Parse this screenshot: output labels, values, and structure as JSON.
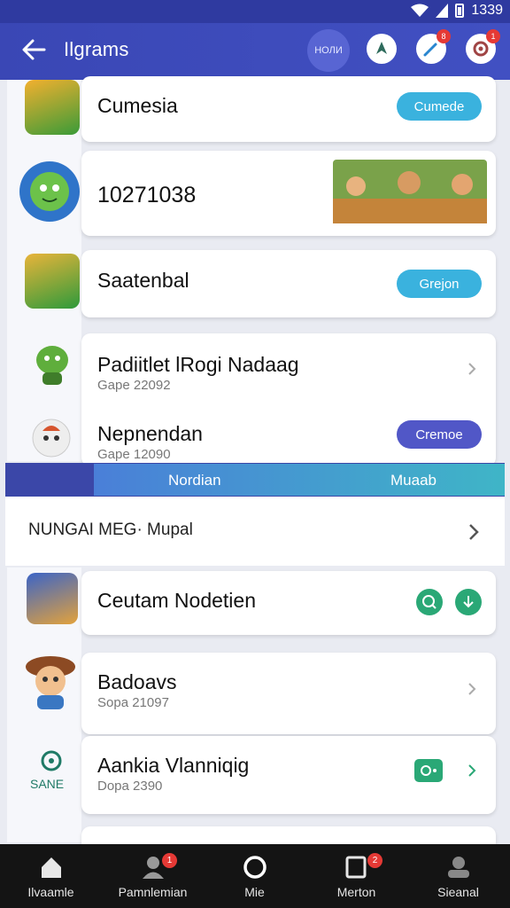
{
  "status_bar": {
    "time": "1339"
  },
  "app_bar": {
    "title": "Ilgrams",
    "pill_label": "НОЛИ",
    "badge_1": "8",
    "badge_2": "1"
  },
  "rows": [
    {
      "name": "Cumesia",
      "button": "Cumede",
      "button_color": "#3ab2de"
    },
    {
      "name": "10271038"
    },
    {
      "name": "Saatenbal",
      "button": "Grejon",
      "button_color": "#3ab2de"
    },
    {
      "name": "Padiitlet lRogi Nadaag",
      "sub": "Gape 22092"
    },
    {
      "name": "Nepnendan",
      "sub": "Gape 12090",
      "button": "Cremoe",
      "button_color": "#5157c7"
    }
  ],
  "gradient_bar": {
    "left": "Nordian",
    "right": "Muaab"
  },
  "section": {
    "title": "NUNGAI MEG· Mupal"
  },
  "rows2": [
    {
      "name": "Ceutam Nodetien"
    },
    {
      "name": "Badoavs",
      "sub": "Sopa 21097"
    },
    {
      "name": "Aankia Vlanniqig",
      "sub": "Dopa 2390",
      "icon_label": "SANE"
    }
  ],
  "bottom_nav": [
    {
      "label": "Ilvaamle"
    },
    {
      "label": "Pamnlemian",
      "badge": "1"
    },
    {
      "label": "Mie"
    },
    {
      "label": "Merton",
      "badge": "2"
    },
    {
      "label": "Sieanal"
    }
  ]
}
